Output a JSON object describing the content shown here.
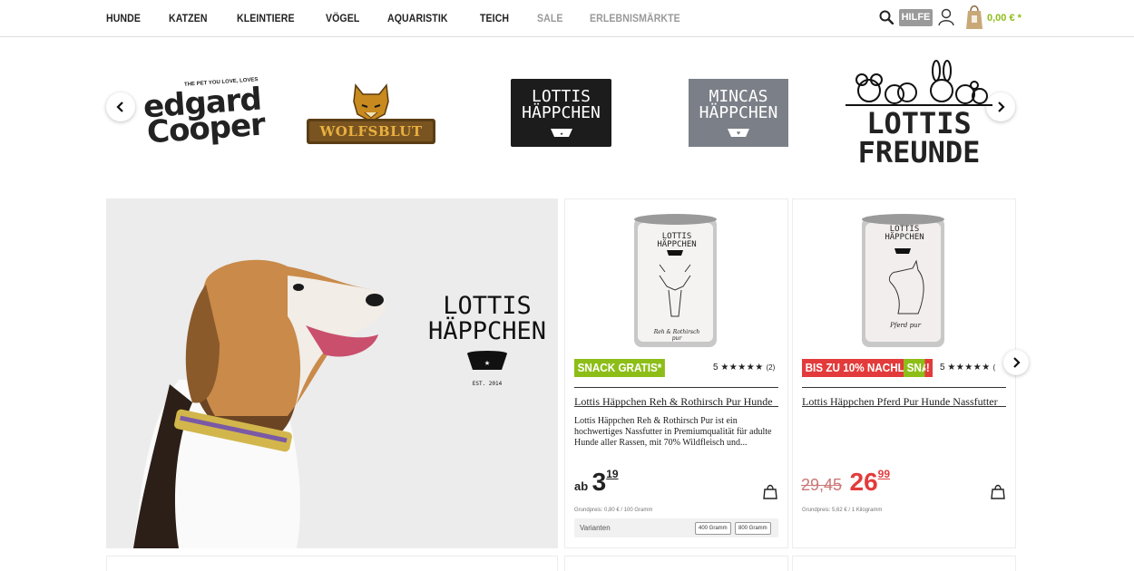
{
  "nav": {
    "items": [
      "HUNDE",
      "KATZEN",
      "KLEINTIERE",
      "VÖGEL",
      "AQUARISTIK",
      "TEICH",
      "SALE",
      "ERLEBNISMÄRKTE"
    ],
    "help_label": "HILFE",
    "cart_total": "0,00 € *",
    "icons": [
      "search-icon",
      "user-icon",
      "shopping-bag-icon"
    ]
  },
  "brands": {
    "items": [
      {
        "tagline": "THE PET YOU LOVE, LOVES",
        "line1": "edgard",
        "line2": "Cooper"
      },
      {
        "name": "WOLFSBLUT"
      },
      {
        "line1": "LOTTIS",
        "line2": "HÄPPCHEN"
      },
      {
        "line1": "MINCAS",
        "line2": "HÄPPCHEN"
      },
      {
        "line1": "LOTTIS",
        "line2": "FREUNDE"
      }
    ],
    "prev_icon": "chevron-left-icon",
    "next_icon": "chevron-right-icon"
  },
  "hero": {
    "logo_line1": "LOTTIS",
    "logo_line2": "HÄPPCHEN",
    "logo_small": "EST. 2014"
  },
  "products": [
    {
      "can_brand1": "LOTTIS",
      "can_brand2": "HÄPPCHEN",
      "can_label": "Reh & Rothirsch pur",
      "badge": "SNACK GRATIS*",
      "rating": "5",
      "stars": "★★★★★",
      "reviews": "(2)",
      "title": "Lottis Häppchen Reh & Rothirsch Pur Hunde",
      "description": "Lottis Häppchen Reh & Rothirsch Pur ist ein hochwertiges Nassfutter in Premiumqualität für adulte Hunde aller Rassen, mit 70% Wildfleisch und...",
      "price_prefix": "ab",
      "price_main": "3",
      "price_cents": "19",
      "base_price": "Grundpreis: 0,80 € / 100 Gramm",
      "variants_label": "Varianten",
      "variants": [
        "400 Gramm",
        "800 Gramm"
      ]
    },
    {
      "can_brand1": "LOTTIS",
      "can_brand2": "HÄPPCHEN",
      "can_label": "Pferd pur",
      "badge": "BIS ZU 10% NACHLASS!",
      "badge2": "SNAC",
      "rating": "5",
      "stars": "★★★★★",
      "reviews": "(",
      "title": "Lottis Häppchen Pferd Pur Hunde Nassfutter",
      "old_price": "29,45",
      "price_main": "26",
      "price_cents": "99",
      "base_price": "Grundpreis: 5,62 € / 1 Kilogramm"
    }
  ],
  "colors": {
    "accent": "#8dbe18",
    "sale": "#e33b3b",
    "muted_nav": "#999999"
  }
}
